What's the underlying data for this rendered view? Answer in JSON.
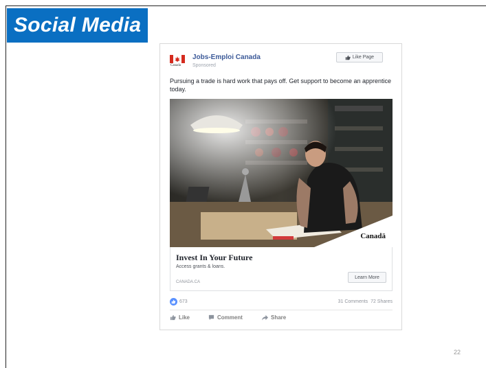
{
  "slide": {
    "title": "Social Media",
    "page_number": "22",
    "colors": {
      "banner": "#0a6fc2",
      "link_blue": "#3b5998"
    }
  },
  "ad": {
    "page_name": "Jobs-Emploi Canada",
    "flag_word": "Canada",
    "sponsored": "Sponsored",
    "like_page_label": "Like Page",
    "post_text": "Pursuing a trade is hard work that pays off. Get support to become an apprentice today.",
    "image_watermark": "Canadä",
    "headline": "Invest In Your Future",
    "subtext": "Access grants & loans.",
    "domain": "CANADA.CA",
    "cta_label": "Learn More",
    "reaction_count": "673",
    "comments": "31 Comments",
    "shares": "72 Shares",
    "actions": {
      "like": "Like",
      "comment": "Comment",
      "share": "Share"
    },
    "icons": [
      "thumbs-up-icon",
      "comment-icon",
      "share-icon",
      "like-reaction-icon",
      "canada-flag-icon"
    ]
  }
}
